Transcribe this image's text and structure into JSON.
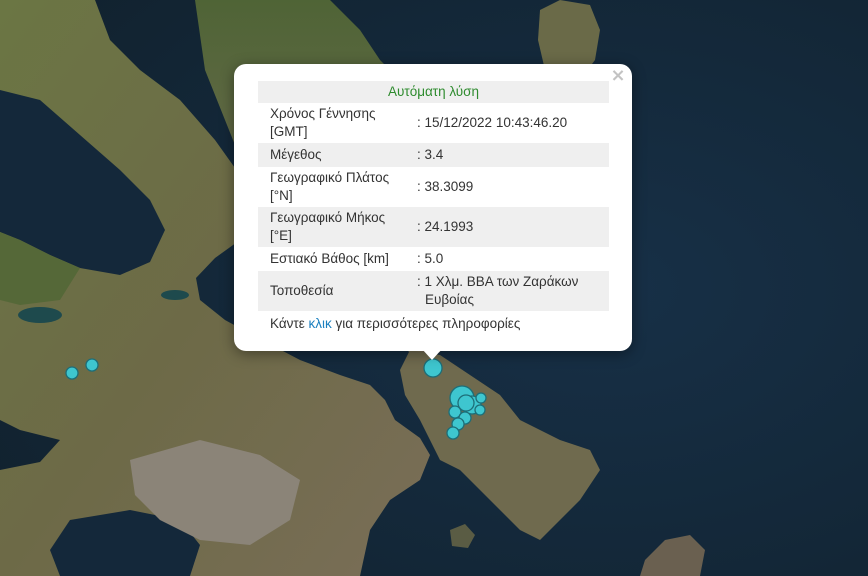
{
  "popup": {
    "title": "Αυτόματη λύση",
    "close_label": "×",
    "rows": [
      {
        "label_line1": "Χρόνος Γέννησης",
        "label_line2": "[GMT]",
        "value": ": 15/12/2022 10:43:46.20"
      },
      {
        "label_line1": "Μέγεθος",
        "label_line2": "",
        "value": ": 3.4"
      },
      {
        "label_line1": "Γεωγραφικό Πλάτος",
        "label_line2": "[°N]",
        "value": ": 38.3099"
      },
      {
        "label_line1": "Γεωγραφικό Μήκος",
        "label_line2": "[°E]",
        "value": ": 24.1993"
      },
      {
        "label_line1": "Εστιακό Βάθος [km]",
        "label_line2": "",
        "value": ": 5.0"
      },
      {
        "label_line1": "Τοποθεσία",
        "label_line2": "",
        "value_line1": ": 1 Χλμ. ΒΒΑ των Ζαράκων",
        "value_line2": "Ευβοίας"
      }
    ],
    "more_prefix": "Κάντε ",
    "more_link": "κλικ",
    "more_suffix": " για περισσότερες πληροφορίες"
  },
  "colors": {
    "sea": "#14283a",
    "land": "#5b6a3c",
    "marker_fill": "#3ec6cf",
    "marker_stroke": "#1d6e78",
    "title_green": "#2e8b2e",
    "link_blue": "#1a7fbf"
  }
}
